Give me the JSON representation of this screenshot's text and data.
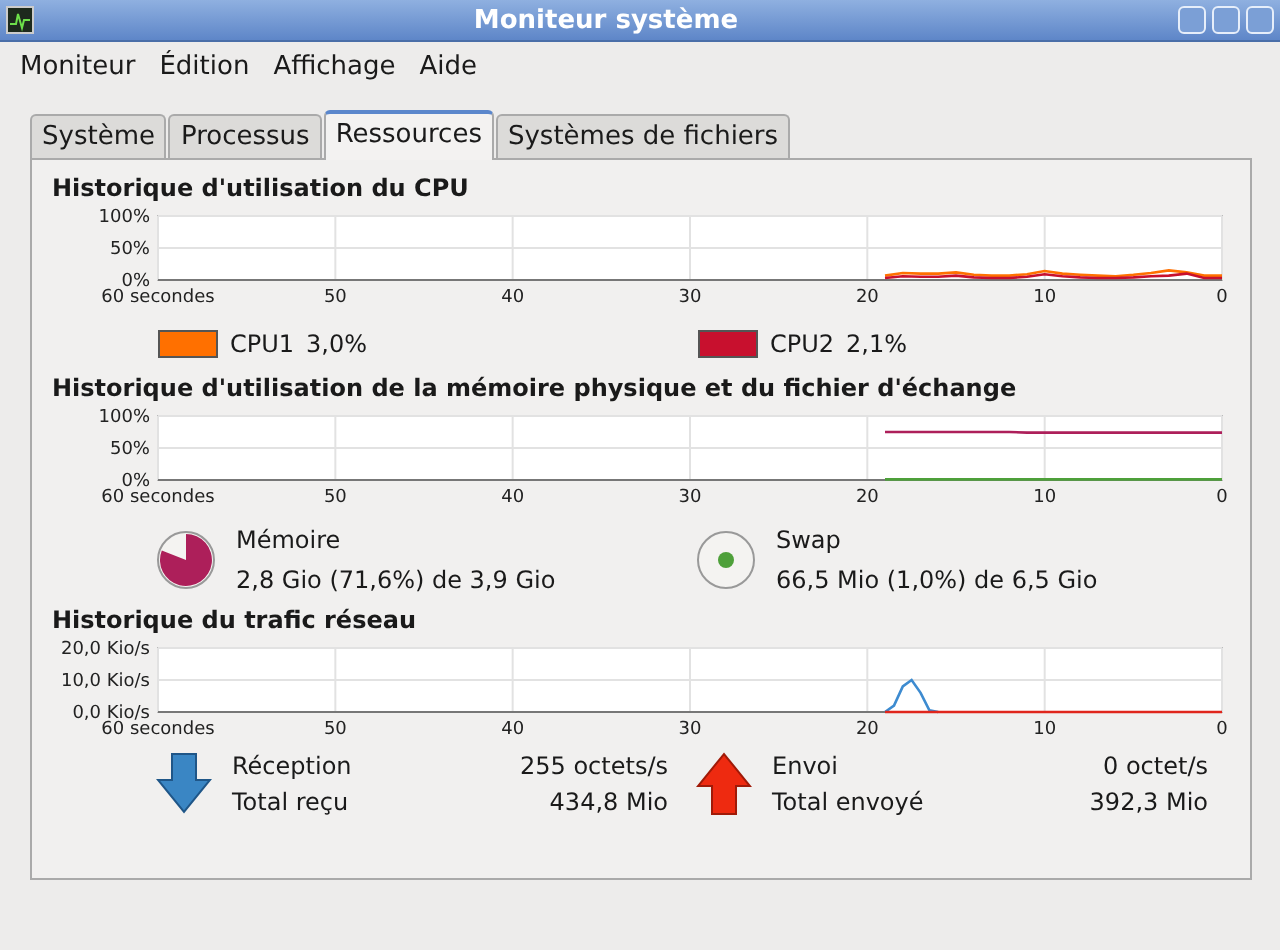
{
  "window": {
    "title": "Moniteur système"
  },
  "menu": [
    "Moniteur",
    "Édition",
    "Affichage",
    "Aide"
  ],
  "tabs": [
    {
      "label": "Système",
      "selected": false
    },
    {
      "label": "Processus",
      "selected": false
    },
    {
      "label": "Ressources",
      "selected": true
    },
    {
      "label": "Systèmes de fichiers",
      "selected": false
    }
  ],
  "cpu": {
    "title": "Historique d'utilisation du CPU",
    "chart_data": {
      "type": "line",
      "grid": true,
      "x": [
        19,
        18,
        17,
        16,
        15,
        14,
        13,
        12,
        11,
        10,
        9,
        8,
        7,
        6,
        5,
        4,
        3,
        2,
        1,
        0
      ],
      "xlim": [
        60,
        0
      ],
      "ylim": [
        0,
        100
      ],
      "xticks": [
        {
          "value": 60,
          "label": "60 secondes"
        },
        50,
        40,
        30,
        20,
        10,
        0
      ],
      "yticks": [
        {
          "value": 0,
          "label": "0%"
        },
        {
          "value": 50,
          "label": "50%"
        },
        {
          "value": 100,
          "label": "100%"
        }
      ],
      "series": [
        {
          "color": "#ff7000",
          "values": [
            7,
            11,
            10,
            10,
            12,
            8,
            7,
            7,
            9,
            14,
            10,
            8,
            7,
            6,
            8,
            11,
            15,
            12,
            7,
            7
          ]
        },
        {
          "color": "#c8102e",
          "values": [
            3,
            6,
            5,
            5,
            7,
            4,
            3,
            3,
            5,
            9,
            6,
            4,
            3,
            3,
            4,
            6,
            7,
            10,
            3,
            3
          ]
        }
      ]
    },
    "legend": [
      {
        "label": "CPU1",
        "value": "3,0%",
        "color": "#ff7000"
      },
      {
        "label": "CPU2",
        "value": "2,1%",
        "color": "#c8102e"
      }
    ]
  },
  "memory": {
    "title": "Historique d'utilisation de la mémoire physique et du fichier d'échange",
    "chart_data": {
      "type": "line",
      "grid": true,
      "x": [
        19,
        18,
        17,
        16,
        15,
        14,
        13,
        12,
        11,
        10,
        9,
        8,
        7,
        6,
        5,
        4,
        3,
        2,
        1,
        0
      ],
      "xlim": [
        60,
        0
      ],
      "ylim": [
        0,
        100
      ],
      "xticks": [
        {
          "value": 60,
          "label": "60 secondes"
        },
        50,
        40,
        30,
        20,
        10,
        0
      ],
      "yticks": [
        {
          "value": 0,
          "label": "0%"
        },
        {
          "value": 50,
          "label": "50%"
        },
        {
          "value": 100,
          "label": "100%"
        }
      ],
      "series": [
        {
          "color": "#ad1f5a",
          "values": [
            75,
            75,
            75,
            75,
            75,
            75,
            75,
            75,
            74,
            74,
            74,
            74,
            74,
            74,
            74,
            74,
            74,
            74,
            74,
            74
          ]
        },
        {
          "color": "#4ea03a",
          "values": [
            1,
            1,
            1,
            1,
            1,
            1,
            1,
            1,
            1,
            1,
            1,
            1,
            1,
            1,
            1,
            1,
            1,
            1,
            1,
            1
          ]
        }
      ]
    },
    "items": [
      {
        "kind": "memory",
        "label": "Mémoire",
        "detail": "2,8 Gio (71,6%) de 3,9 Gio",
        "color": "#ad1f5a"
      },
      {
        "kind": "swap",
        "label": "Swap",
        "detail": "66,5 Mio (1,0%) de 6,5 Gio",
        "color": "#4ea03a"
      }
    ]
  },
  "network": {
    "title": "Historique du trafic réseau",
    "chart_data": {
      "type": "line",
      "grid": true,
      "x": [
        19,
        18.5,
        18,
        17.5,
        17,
        16.5,
        16,
        15,
        14,
        13,
        12,
        11,
        10,
        9,
        8,
        7,
        6,
        5,
        4,
        3,
        2,
        1,
        0
      ],
      "xlim": [
        60,
        0
      ],
      "ylim": [
        0,
        20
      ],
      "xticks": [
        {
          "value": 60,
          "label": "60 secondes"
        },
        50,
        40,
        30,
        20,
        10,
        0
      ],
      "yticks": [
        {
          "value": 0,
          "label": "0,0 Kio/s"
        },
        {
          "value": 10,
          "label": "10,0 Kio/s"
        },
        {
          "value": 20,
          "label": "20,0 Kio/s"
        }
      ],
      "series": [
        {
          "color": "#3d8bd0",
          "values": [
            0,
            2,
            8,
            10,
            6,
            0.5,
            0,
            null,
            null,
            null,
            null,
            null,
            null,
            null,
            null,
            null,
            null,
            null,
            null,
            null,
            null,
            null,
            null
          ]
        },
        {
          "color": "#e0261c",
          "values": [
            0,
            0,
            0,
            0,
            0,
            0,
            0,
            0,
            0,
            0,
            0,
            0,
            0,
            0,
            0,
            0,
            0,
            0,
            0,
            0,
            0,
            0,
            0
          ]
        }
      ]
    },
    "items": [
      {
        "kind": "receive",
        "label": "Réception",
        "rate": "255 octets/s",
        "total_label": "Total reçu",
        "total": "434,8 Mio"
      },
      {
        "kind": "send",
        "label": "Envoi",
        "rate": "0 octet/s",
        "total_label": "Total envoyé",
        "total": "392,3 Mio"
      }
    ]
  }
}
